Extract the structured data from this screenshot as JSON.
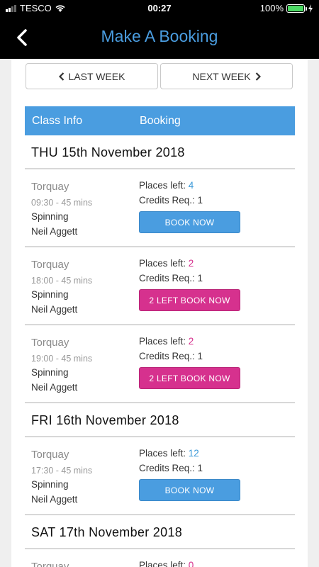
{
  "status": {
    "carrier": "TESCO",
    "time": "00:27",
    "battery": "100%"
  },
  "header": {
    "title": "Make A Booking"
  },
  "nav": {
    "last_week": "LAST WEEK",
    "next_week": "NEXT WEEK"
  },
  "table": {
    "col1": "Class Info",
    "col2": "Booking"
  },
  "days": [
    {
      "label": "THU 15th November 2018",
      "classes": [
        {
          "location": "Torquay",
          "time": "09:30 - 45 mins",
          "type": "Spinning",
          "instructor": "Neil Aggett",
          "places_label": "Places left:",
          "places": "4",
          "credits": "Credits Req.: 1",
          "button": "BOOK NOW"
        },
        {
          "location": "Torquay",
          "time": "18:00 - 45 mins",
          "type": "Spinning",
          "instructor": "Neil Aggett",
          "places_label": "Places left:",
          "places": "2",
          "credits": "Credits Req.: 1",
          "button": "2 LEFT BOOK NOW"
        },
        {
          "location": "Torquay",
          "time": "19:00 - 45 mins",
          "type": "Spinning",
          "instructor": "Neil Aggett",
          "places_label": "Places left:",
          "places": "2",
          "credits": "Credits Req.: 1",
          "button": "2 LEFT BOOK NOW"
        }
      ]
    },
    {
      "label": "FRI 16th November 2018",
      "classes": [
        {
          "location": "Torquay",
          "time": "17:30 - 45 mins",
          "type": "Spinning",
          "instructor": "Neil Aggett",
          "places_label": "Places left:",
          "places": "12",
          "credits": "Credits Req.: 1",
          "button": "BOOK NOW"
        }
      ]
    },
    {
      "label": "SAT 17th November 2018",
      "classes": [
        {
          "location": "Torquay",
          "places_label": "Places left:",
          "places": "0"
        }
      ]
    }
  ],
  "colors": {
    "accent": "#4a9de0",
    "pink": "#d6318e",
    "header_bg": "#000000"
  }
}
